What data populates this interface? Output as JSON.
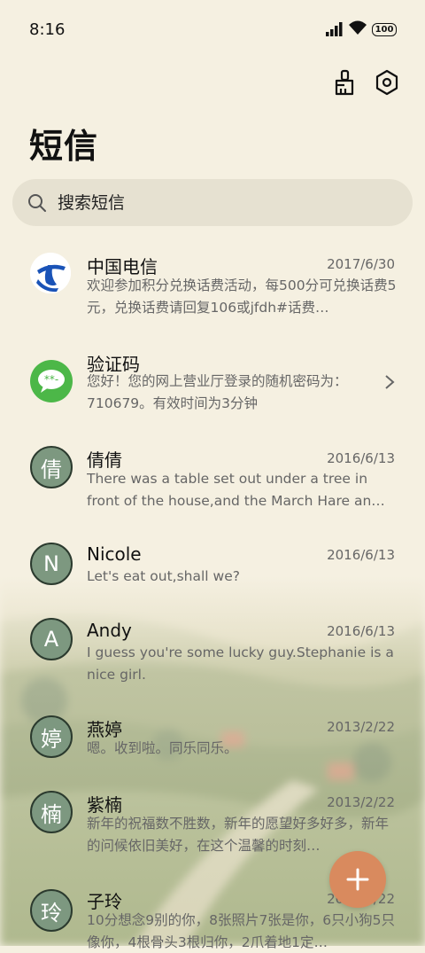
{
  "status": {
    "time": "8:16",
    "battery": "100"
  },
  "header": {
    "title": "短信"
  },
  "search": {
    "placeholder": "搜索短信"
  },
  "conversations": [
    {
      "name": "中国电信",
      "date": "2017/6/30",
      "preview": "欢迎参加积分兑换话费活动，每500分可兑换话费5元，兑换话费请回复106或jfdh#话费…",
      "avatar_type": "china-telecom-logo"
    },
    {
      "name": "验证码",
      "date": "",
      "preview": "您好！您的网上营业厅登录的随机密码为：710679。有效时间为3分钟",
      "avatar_type": "message-bubble"
    },
    {
      "name": "倩倩",
      "date": "2016/6/13",
      "preview": "There was a table set out under a tree in front of the house,and the March Hare an…",
      "avatar_letter": "倩"
    },
    {
      "name": "Nicole",
      "date": "2016/6/13",
      "preview": "Let's eat out,shall we?",
      "avatar_letter": "N"
    },
    {
      "name": "Andy",
      "date": "2016/6/13",
      "preview": "I guess you're some lucky guy.Stephanie is a nice girl.",
      "avatar_letter": "A"
    },
    {
      "name": "燕婷",
      "date": "2013/2/22",
      "preview": "嗯。收到啦。同乐同乐。",
      "avatar_letter": "婷"
    },
    {
      "name": "紫楠",
      "date": "2013/2/22",
      "preview": "新年的祝福数不胜数，新年的愿望好多好多，新年的问候依旧美好，在这个温馨的时刻…",
      "avatar_letter": "楠"
    },
    {
      "name": "子玲",
      "date": "2013/2/22",
      "preview": "10分想念9别的你，8张照片7张是你，6只小狗5只像你，4根骨头3根归你，2爪着地1定…",
      "avatar_letter": "玲"
    }
  ],
  "colors": {
    "accent": "#d98a5e",
    "avatar_bg": "#7d9880",
    "background": "#f5f0e1",
    "search_bg": "#e6e1d1"
  }
}
